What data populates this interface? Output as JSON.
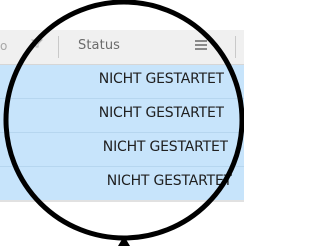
{
  "grid": {
    "previous_column": {
      "header_text": "o",
      "menu_icon": "filter-icon"
    },
    "column": {
      "header": "Status",
      "menu_icon": "menu-icon"
    },
    "rows": [
      {
        "status": "NICHT GESTARTET"
      },
      {
        "status": "NICHT GESTARTET"
      },
      {
        "status": "NICHT GESTARTET"
      },
      {
        "status": "NICHT GESTARTET"
      }
    ],
    "selected_row_color": "#c7e4fb"
  },
  "overlay": {
    "type": "magnifier-loupe",
    "icon": "magnifier-icon"
  }
}
